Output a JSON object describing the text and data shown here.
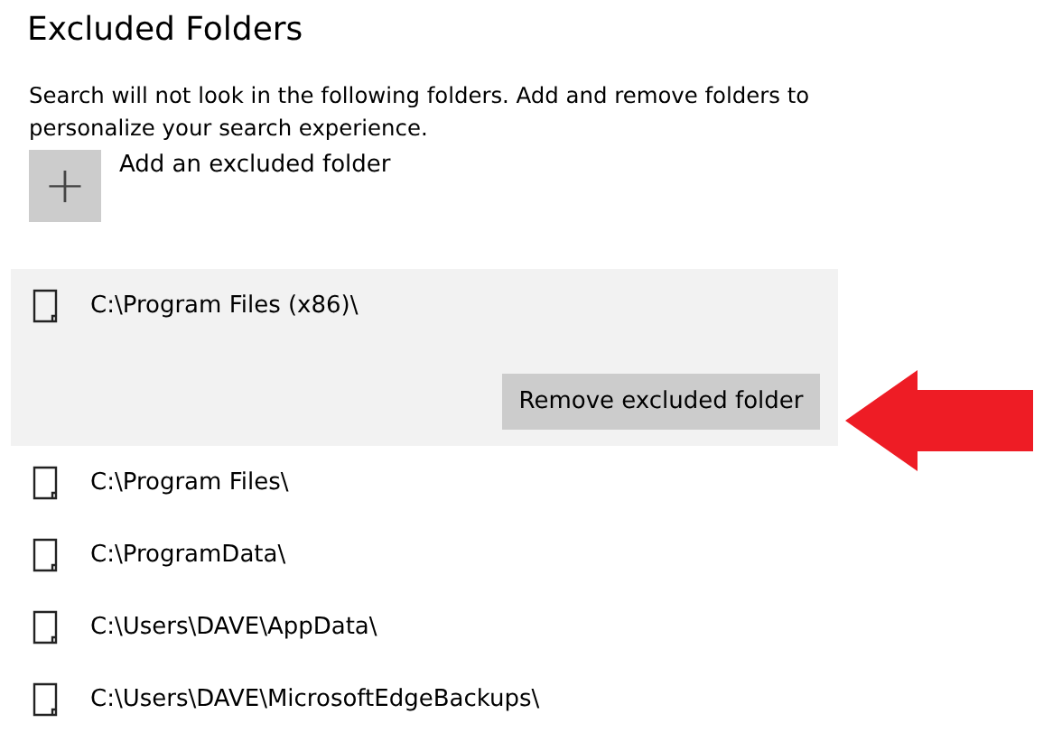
{
  "title": "Excluded Folders",
  "description": "Search will not look in the following folders. Add and remove folders to personalize your search experience.",
  "add_button": {
    "icon": "+",
    "label": "Add an excluded folder"
  },
  "folders": [
    {
      "path": "C:\\Program Files (x86)\\",
      "selected": true,
      "action": "Remove excluded folder"
    },
    {
      "path": "C:\\Program Files\\",
      "selected": false
    },
    {
      "path": "C:\\ProgramData\\",
      "selected": false
    },
    {
      "path": "C:\\Users\\DAVE\\AppData\\",
      "selected": false
    },
    {
      "path": "C:\\Users\\DAVE\\MicrosoftEdgeBackups\\",
      "selected": false
    }
  ]
}
